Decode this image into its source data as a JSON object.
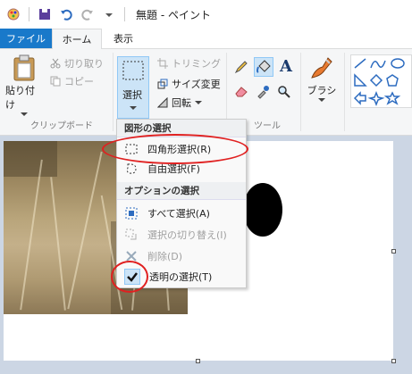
{
  "window": {
    "title": "無題 - ペイント"
  },
  "tabs": {
    "file": "ファイル",
    "home": "ホーム",
    "view": "表示"
  },
  "ribbon": {
    "clipboard": {
      "paste": "貼り付け",
      "cut": "切り取り",
      "copy": "コピー",
      "group_label": "クリップボード"
    },
    "image": {
      "select": "選択",
      "crop": "トリミング",
      "resize": "サイズ変更",
      "rotate": "回転"
    },
    "tools": {
      "group_label": "ツール"
    },
    "brushes": {
      "label": "ブラシ"
    }
  },
  "menu": {
    "section1_header": "図形の選択",
    "rect_select": "四角形選択(R)",
    "free_select": "自由選択(F)",
    "section2_header": "オプションの選択",
    "select_all": "すべて選択(A)",
    "invert_select": "選択の切り替え(I)",
    "delete": "削除(D)",
    "transparent_select": "透明の選択(T)"
  },
  "colors": {
    "accent": "#1979ca",
    "highlight": "#e02020",
    "ribbon": "#f5f6f7"
  }
}
